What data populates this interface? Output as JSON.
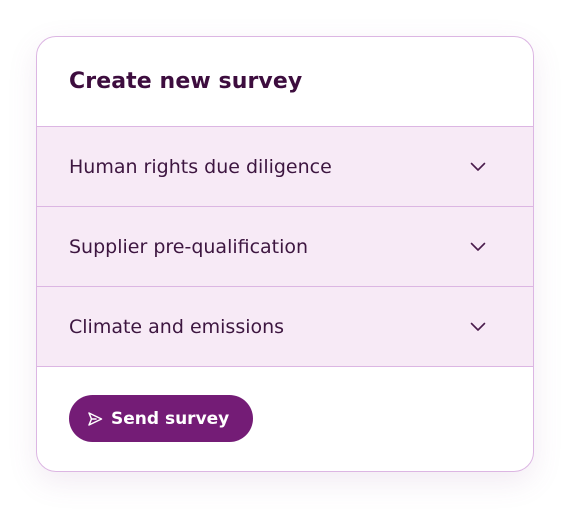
{
  "survey_card": {
    "title": "Create new survey",
    "sections": [
      {
        "label": "Human rights due diligence",
        "icon": "chevron-down-icon"
      },
      {
        "label": "Supplier pre-qualification",
        "icon": "chevron-down-icon"
      },
      {
        "label": "Climate and emissions",
        "icon": "chevron-down-icon"
      }
    ],
    "send_button": {
      "label": "Send survey",
      "icon": "send-icon"
    }
  },
  "colors": {
    "title_text": "#3d0d3e",
    "section_background": "#f7eaf6",
    "border": "#dcb6e3",
    "button_background": "#741c76",
    "button_text": "#ffffff"
  }
}
